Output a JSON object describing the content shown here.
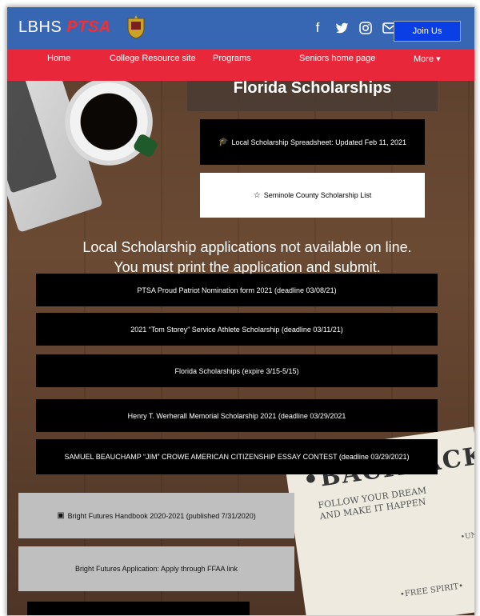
{
  "header": {
    "brand_text": "LBHS",
    "brand_accent": "PTSA",
    "social_icons": [
      "facebook-icon",
      "twitter-icon",
      "instagram-icon",
      "mail-icon"
    ],
    "join_label": "Join Us"
  },
  "nav": {
    "items": [
      "Home",
      "College Resource site",
      "Programs",
      "Seniors home page",
      "More ▾"
    ]
  },
  "page_title": "Florida Scholarships",
  "top_buttons": [
    {
      "icon": "🎓",
      "label": "Local Scholarship Spreadsheet: Updated Feb 11, 2021"
    },
    {
      "icon": "☆",
      "label": "Seminole County Scholarship List"
    }
  ],
  "notice": {
    "line1": "Local Scholarship applications not available on line.",
    "line2": "You must print the application and submit."
  },
  "scholarships": [
    "PTSA Proud Patriot Nomination form 2021 (deadline 03/08/21)",
    "2021 “Tom Storey” Service Athlete Scholarship (deadline 03/11/21)",
    "Florida Scholarships (expire 3/15-5/15)",
    "Henry T. Werherall Memorial Scholarship 2021 (deadline 03/29/2021",
    "SAMUEL BEAUCHAMP “JIM” CROWE AMERICAN CITIZENSHIP ESSAY CONTEST (deadline 03/29/2021)"
  ],
  "bright_futures": [
    {
      "icon": "▣",
      "label": "Bright Futures Handbook 2020-2021 (published 7/31/2020)"
    },
    {
      "label": "Bright Futures Application: Apply through FFAA link"
    }
  ],
  "newspaper": {
    "headline": "•BACKPACKER•",
    "sub": "FOLLOW YOUR DREAM AND MAKE IT HAPPEN",
    "free": "•FREE SPIRIT•",
    "side": "•UNPL"
  },
  "colors": {
    "header_bg": "#3766b3",
    "nav_bg": "#e8283a",
    "join_bg": "#0a3fe6",
    "ptsa_red": "#ff2a2a"
  }
}
